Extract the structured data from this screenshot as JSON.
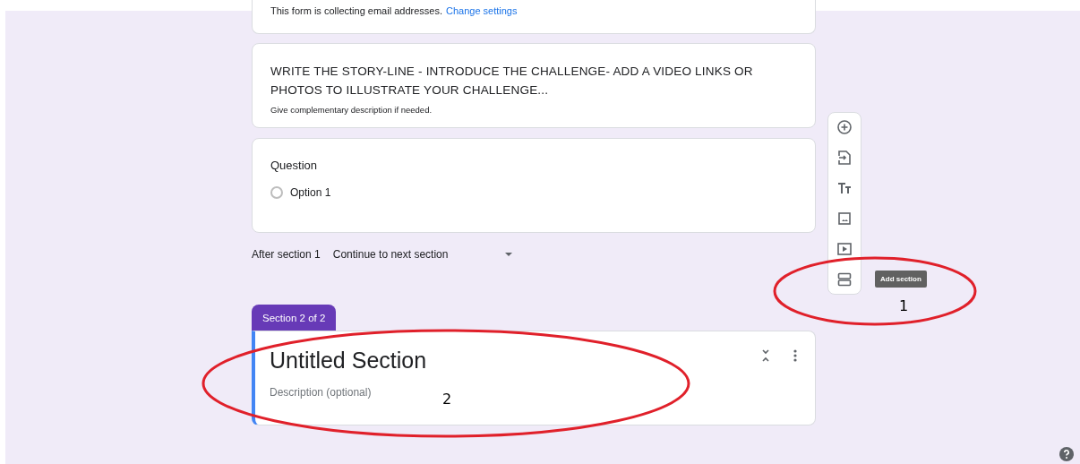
{
  "settings_card": {
    "text": "This form is collecting email addresses.",
    "link": "Change settings"
  },
  "title_card": {
    "title": "WRITE THE STORY-LINE - INTRODUCE THE CHALLENGE- ADD A VIDEO LINKS OR PHOTOS TO ILLUSTRATE YOUR CHALLENGE...",
    "description": "Give complementary description if needed."
  },
  "question_card": {
    "title": "Question",
    "options": [
      {
        "label": "Option 1",
        "selected": false
      }
    ]
  },
  "after_section": {
    "label": "After section 1",
    "value": "Continue to next section"
  },
  "toolbar": {
    "items": [
      {
        "kind": "add"
      },
      {
        "kind": "import"
      },
      {
        "kind": "title"
      },
      {
        "kind": "image"
      },
      {
        "kind": "video"
      },
      {
        "kind": "section",
        "tooltip": "Add section"
      }
    ]
  },
  "section": {
    "tab": "Section 2 of 2",
    "title": "Untitled Section",
    "description_placeholder": "Description (optional)"
  },
  "annotations": [
    {
      "label": "1"
    },
    {
      "label": "2"
    }
  ]
}
